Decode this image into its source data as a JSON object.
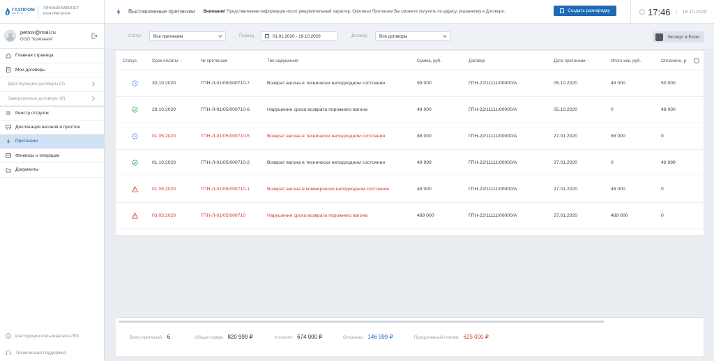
{
  "brand": {
    "name": "ГАЗПРОМ",
    "sub": "НЕФТЬ",
    "caption_line1": "ЛИЧНЫЙ КАБИНЕТ",
    "caption_line2": "КОНТРАГЕНТА"
  },
  "profile": {
    "email": "petrov@mail.ru",
    "company": "ООО \"Компания\""
  },
  "sidebar": {
    "items": [
      {
        "label": "Главная страница",
        "icon": "home-icon"
      },
      {
        "label": "Мои договоры",
        "icon": "contracts-icon"
      },
      {
        "label": "Действующие договоры (3)",
        "icon": "chevron-right-icon"
      },
      {
        "label": "Завершенные договоры (8)",
        "icon": "chevron-right-icon"
      },
      {
        "label": "Реестр отгрузок",
        "icon": "list-icon"
      },
      {
        "label": "Дислокация вагонов и простои",
        "icon": "wagon-icon"
      },
      {
        "label": "Претензии",
        "icon": "bolt-icon"
      },
      {
        "label": "Финансы и операции",
        "icon": "finance-icon"
      },
      {
        "label": "Документы",
        "icon": "documents-icon"
      }
    ],
    "bottom": [
      {
        "label": "Инструкция пользователя ЛКК",
        "icon": "info-icon"
      },
      {
        "label": "Техническая поддержка",
        "icon": "support-icon"
      }
    ]
  },
  "header": {
    "title": "Выставленные претензии",
    "notice_bold": "Внимание!",
    "notice_text": " Представленная информация носит уведомительный характер. Оригинал Претензии Вы сможете получить по адресу, указанному в Договоре.",
    "create_button": "Создать разнарядку",
    "time": "17:46",
    "date": "19.10.2020"
  },
  "filters": {
    "status_label": "Статус",
    "status_value": "Все претензии",
    "period_label": "Период",
    "period_value": "01.01.2020  -  19.10.2020",
    "contract_label": "Договор",
    "contract_value": "Все договоры",
    "export_button": "Экспорт в Excel"
  },
  "table": {
    "columns": [
      "Статус",
      "Срок оплаты",
      "№ претензии",
      "Тип нарушения",
      "Сумма, руб.",
      "Договор",
      "Дата претензии",
      "Итого иск, руб.",
      "Оплачено, р"
    ],
    "rows": [
      {
        "status": "pending",
        "due": "30.10.2020",
        "num": "ГПН-Л-01/05/000710-7",
        "type": "Возврат вагона в технически неподходном состоянии",
        "sum": "99 000",
        "contract": "ГПН-22/11111/00000/А",
        "date": "05.10.2020",
        "total": "49 000",
        "paid": "50 000",
        "overdue": false
      },
      {
        "status": "paid",
        "due": "28.10.2020",
        "num": "ГПН-Л-01/05/000710-6",
        "type": "Нарушение срока возврата порожнего вагона",
        "sum": "48 000",
        "contract": "ГПН-22/11111/00000/А",
        "date": "05.10.2020",
        "total": "0",
        "paid": "48 000",
        "overdue": false
      },
      {
        "status": "pending",
        "due": "01.05.2020",
        "num": "ГПН-Л-01/05/000710-5",
        "type": "Возврат вагона в технически неподходном состоянии",
        "sum": "88 000",
        "contract": "ГПН-22/11111/00000/А",
        "date": "27.01.2020",
        "total": "88 000",
        "paid": "0",
        "overdue": true
      },
      {
        "status": "paid",
        "due": "01.10.2020",
        "num": "ГПН-Л-01/05/000710-2",
        "type": "Возврат вагона в технически неподходном состоянии",
        "sum": "48 999",
        "contract": "ГПН-22/11111/00000/А",
        "date": "27.01.2020",
        "total": "0",
        "paid": "48 999",
        "overdue": false
      },
      {
        "status": "warning",
        "due": "01.05.2020",
        "num": "ГПН-Л-01/05/000710-1",
        "type": "Возврат вагона в коммерчески неподходном состоянии",
        "sum": "48 000",
        "contract": "ГПН-22/11111/00000/А",
        "date": "27.01.2020",
        "total": "48 000",
        "paid": "0",
        "overdue": true
      },
      {
        "status": "warning",
        "due": "03.03.2020",
        "num": "ГПН-Л-01/05/000710",
        "type": "Нарушение срока возврата порожнего вагона",
        "sum": "489 000",
        "contract": "ГПН-22/11111/00000/А",
        "date": "27.01.2020",
        "total": "489 000",
        "paid": "0",
        "overdue": true
      }
    ]
  },
  "summary": {
    "count_label": "Всего претензий:",
    "count_value": "6",
    "total_label": "Общая сумма:",
    "total_value": "820 999 ₽",
    "topay_label": "К оплате:",
    "topay_value": "674 000 ₽",
    "paid_label": "Оплачено:",
    "paid_value": "146 999 ₽",
    "overdue_label": "Просроченный платеж:",
    "overdue_value": "625 000 ₽"
  },
  "colors": {
    "accent": "#1e6ab7",
    "danger": "#d63a2f",
    "success": "#2ea44f",
    "active_bg": "#cfe1f3"
  }
}
